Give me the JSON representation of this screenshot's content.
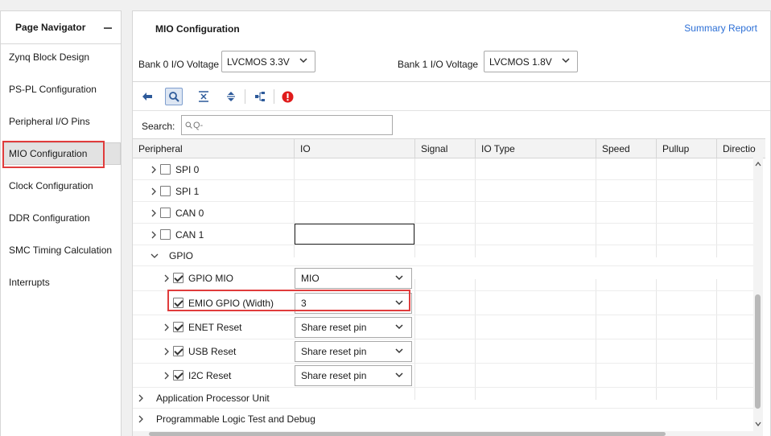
{
  "navigator": {
    "title": "Page Navigator",
    "items": [
      {
        "label": "Zynq Block Design"
      },
      {
        "label": "PS-PL Configuration"
      },
      {
        "label": "Peripheral I/O Pins"
      },
      {
        "label": "MIO Configuration",
        "selected": true
      },
      {
        "label": "Clock Configuration"
      },
      {
        "label": "DDR Configuration"
      },
      {
        "label": "SMC Timing Calculation"
      },
      {
        "label": "Interrupts"
      }
    ]
  },
  "main": {
    "title": "MIO Configuration",
    "summary_link": "Summary Report",
    "bank0": {
      "label": "Bank 0 I/O Voltage",
      "value": "LVCMOS 3.3V"
    },
    "bank1": {
      "label": "Bank 1 I/O Voltage",
      "value": "LVCMOS 1.8V"
    },
    "toolbar": [
      "back-arrow-icon",
      "search-icon",
      "collapse-all-icon",
      "expand-all-icon",
      "hierarchy-icon",
      "error-icon"
    ],
    "search": {
      "label": "Search:",
      "placeholder": "Q-"
    }
  },
  "table": {
    "columns": [
      "Peripheral",
      "IO",
      "Signal",
      "IO Type",
      "Speed",
      "Pullup",
      "Directio"
    ],
    "rows": [
      {
        "label": "SPI 0",
        "checked": false,
        "io": ""
      },
      {
        "label": "SPI 1",
        "checked": false,
        "io": ""
      },
      {
        "label": "CAN 0",
        "checked": false,
        "io": ""
      },
      {
        "label": "CAN 1",
        "checked": false,
        "io": ""
      },
      {
        "label": "GPIO",
        "expanded": true
      },
      {
        "label": "GPIO MIO",
        "checked": true,
        "io": "MIO"
      },
      {
        "label": "EMIO GPIO (Width)",
        "checked": true,
        "io": "3"
      },
      {
        "label": "ENET Reset",
        "checked": true,
        "io": "Share reset pin"
      },
      {
        "label": "USB Reset",
        "checked": true,
        "io": "Share reset pin"
      },
      {
        "label": "I2C Reset",
        "checked": true,
        "io": "Share reset pin"
      },
      {
        "label": "Application Processor Unit"
      },
      {
        "label": "Programmable Logic Test and Debug"
      }
    ]
  },
  "colors": {
    "highlight": "#e03c3c",
    "link": "#2c6fd6",
    "selected_bg": "#e2e2e2"
  }
}
